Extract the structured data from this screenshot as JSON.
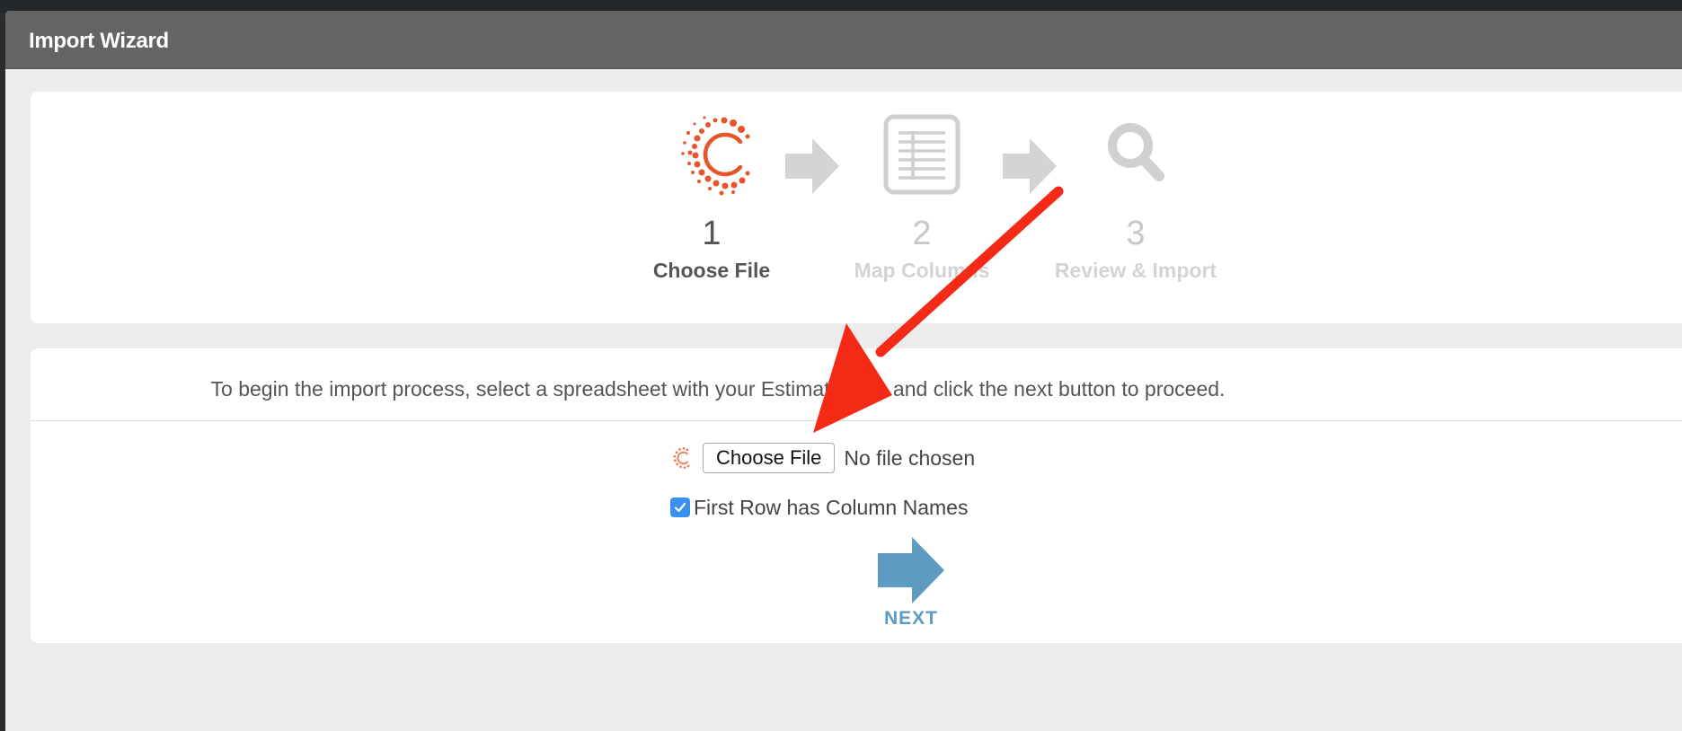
{
  "window": {
    "title": "Import Wizard"
  },
  "wizard": {
    "steps": [
      {
        "number": "1",
        "label": "Choose File",
        "state": "active",
        "icon": "import-logo-icon"
      },
      {
        "number": "2",
        "label": "Map Columns",
        "state": "inactive",
        "icon": "spreadsheet-icon"
      },
      {
        "number": "3",
        "label": "Review & Import",
        "state": "inactive",
        "icon": "magnifier-icon"
      }
    ]
  },
  "form": {
    "instruction": "To begin the import process, select a spreadsheet with your Estimate data and click the next button to proceed.",
    "file_button_label": "Choose File",
    "file_status": "No file chosen",
    "checkbox_label": "First Row has Column Names",
    "checkbox_checked": true,
    "next_label": "NEXT"
  },
  "colors": {
    "accent_orange": "#e8542a",
    "next_blue": "#5e9bc2",
    "annotation_red": "#f42a16",
    "checkbox_blue": "#3a8ff0"
  }
}
